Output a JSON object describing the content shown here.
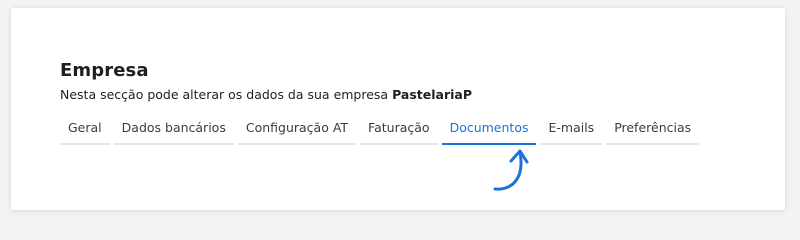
{
  "section": {
    "title": "Empresa",
    "subtitle_prefix": "Nesta secção pode alterar os dados da sua empresa ",
    "company_name": "PastelariaP"
  },
  "tabs": [
    {
      "label": "Geral",
      "active": false
    },
    {
      "label": "Dados bancários",
      "active": false
    },
    {
      "label": "Configuração AT",
      "active": false
    },
    {
      "label": "Faturação",
      "active": false
    },
    {
      "label": "Documentos",
      "active": true
    },
    {
      "label": "E-mails",
      "active": false
    },
    {
      "label": "Preferências",
      "active": false
    }
  ],
  "colors": {
    "accent": "#1a73d9",
    "text": "#1f1f1f",
    "tab_text": "#3c3c3c",
    "tab_underline": "#e6e6e6"
  },
  "annotation": {
    "icon": "curved-arrow-icon"
  }
}
